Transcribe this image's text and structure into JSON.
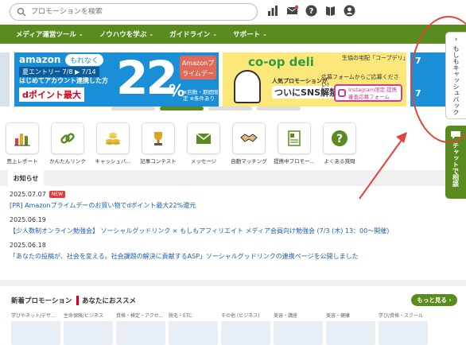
{
  "search": {
    "placeholder": "プロモーションを検索"
  },
  "nav": {
    "items": [
      {
        "label": "メディア運営ツール"
      },
      {
        "label": "ノウハウを学ぶ"
      },
      {
        "label": "ガイドライン"
      },
      {
        "label": "サポート"
      }
    ]
  },
  "banners": {
    "amazon": {
      "logo": "amazon",
      "motto": "もれなく",
      "entry": "夏エントリー 7/8 ▶ 7/14",
      "first": "はじめてアカウント連携した方",
      "dpoint": "dポイント最大",
      "big": "22",
      "pct": "%",
      "prime": "Amazonプライムデー",
      "sub": "※回数・期間限定 ※条件あり"
    },
    "coop": {
      "logo": "co-op deli",
      "logo2": "生協の宅配「コープデリ」",
      "pop": "人気プロモーションが",
      "sns": "ついにSNS解禁!",
      "form": "応募フォームからご応募ください!",
      "insta": "Instagram限定 提携審査応募フォーム"
    },
    "right": {
      "n1": "7",
      "n2": "7"
    }
  },
  "categories": [
    {
      "label": "売上レポート",
      "icon": "bar-chart-icon"
    },
    {
      "label": "かんたんリンク",
      "icon": "link-icon"
    },
    {
      "label": "キャッシュバ...",
      "icon": "coins-icon"
    },
    {
      "label": "記事コンテスト",
      "icon": "trophy-icon"
    },
    {
      "label": "メッセージ",
      "icon": "envelope-icon"
    },
    {
      "label": "自動マッチング",
      "icon": "handshake-icon"
    },
    {
      "label": "提携中プロモー...",
      "icon": "document-icon"
    },
    {
      "label": "よくある質問",
      "icon": "question-icon"
    }
  ],
  "news": {
    "tab": "お知らせ",
    "items": [
      {
        "date": "2025.07.07",
        "badge": "NEW",
        "title": "[PR] Amazonプライムデーのお買い物でdポイント最大22%還元"
      },
      {
        "date": "2025.06.19",
        "badge": "",
        "title": "【少人数制オンライン勉強会】 ソーシャルグッドリンク × もしもアフィリエイト メディア会員向け勉強会 (7/3 (木) 13：00～開催)"
      },
      {
        "date": "2025.06.18",
        "badge": "",
        "title": "「あなたの投稿が、社会を変える。社会課題の解決に貢献するASP」ソーシャルグッドリンクの連携ページを公開しました"
      }
    ]
  },
  "promotions": {
    "title": "新着プロモーション",
    "subtitle": "あなたにおススメ",
    "more": "もっと見る",
    "cards": [
      {
        "label": "学びやネット/デザ..."
      },
      {
        "label": "生命保険/ビジネス"
      },
      {
        "label": "資格・検定・アクセ..."
      },
      {
        "label": "脱毛・ETC"
      },
      {
        "label": "その他 (ビジネス)"
      },
      {
        "label": "美容・講座"
      },
      {
        "label": "美容・健康"
      },
      {
        "label": "学び/資格・スクール"
      }
    ]
  },
  "side": {
    "back": "もしもキャッシュバック",
    "chat": "チャットで相談"
  },
  "colors": {
    "brand_green": "#5a8b1f",
    "amazon_blue": "#1a8fd8",
    "annotation_red": "#e0443a"
  }
}
